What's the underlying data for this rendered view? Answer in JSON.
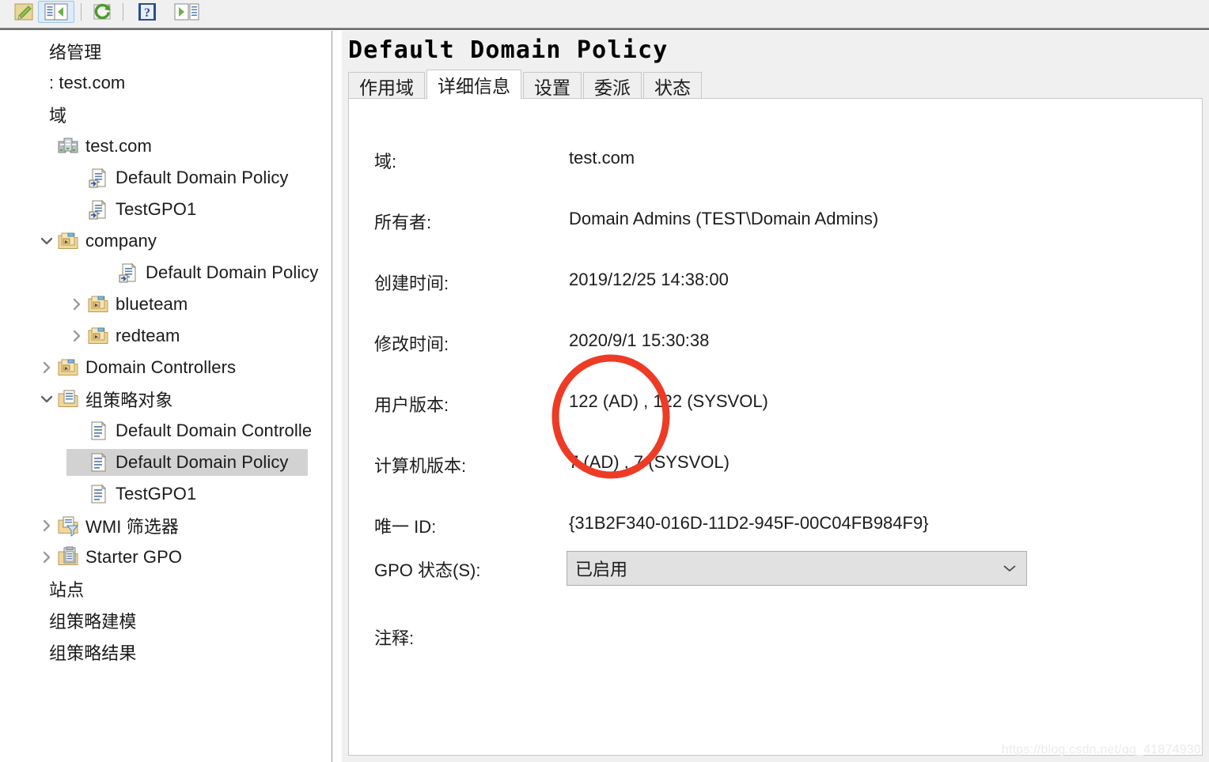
{
  "toolbar": {
    "buttons": [
      {
        "name": "edit-icon",
        "label": "编辑"
      },
      {
        "name": "show-hide-tree-icon",
        "label": "显示/隐藏控制台树",
        "selected": true
      },
      {
        "name": "refresh-icon",
        "label": "刷新"
      },
      {
        "name": "help-icon",
        "label": "帮助"
      },
      {
        "name": "export-icon",
        "label": "导出列表"
      }
    ]
  },
  "sidebar": {
    "items": [
      {
        "label": "络管理",
        "icon": "none",
        "indent": 0,
        "chevron": "none",
        "selected": false,
        "clipped": true
      },
      {
        "label": ": test.com",
        "icon": "none",
        "indent": 0,
        "chevron": "none",
        "selected": false,
        "clipped": true
      },
      {
        "label": "域",
        "icon": "none",
        "indent": 0,
        "chevron": "none",
        "selected": false,
        "clipped": true
      },
      {
        "label": "test.com",
        "icon": "domain-icon",
        "indent": 1,
        "chevron": "none",
        "selected": false
      },
      {
        "label": "Default Domain Policy",
        "icon": "gpo-link-icon",
        "indent": 2,
        "chevron": "none",
        "selected": false
      },
      {
        "label": "TestGPO1",
        "icon": "gpo-link-icon",
        "indent": 2,
        "chevron": "none",
        "selected": false
      },
      {
        "label": "company",
        "icon": "ou-folder-icon",
        "indent": 1,
        "chevron": "down",
        "selected": false
      },
      {
        "label": "Default Domain Policy",
        "icon": "gpo-link-icon",
        "indent": 3,
        "chevron": "none",
        "selected": false
      },
      {
        "label": "blueteam",
        "icon": "ou-folder-icon",
        "indent": 2,
        "chevron": "right",
        "selected": false
      },
      {
        "label": "redteam",
        "icon": "ou-folder-icon",
        "indent": 2,
        "chevron": "right",
        "selected": false
      },
      {
        "label": "Domain Controllers",
        "icon": "ou-folder-icon",
        "indent": 1,
        "chevron": "right",
        "selected": false
      },
      {
        "label": "组策略对象",
        "icon": "gpo-container-icon",
        "indent": 1,
        "chevron": "down",
        "selected": false
      },
      {
        "label": "Default Domain Controlle",
        "icon": "gpo-icon",
        "indent": 2,
        "chevron": "none",
        "selected": false
      },
      {
        "label": "Default Domain Policy",
        "icon": "gpo-icon",
        "indent": 2,
        "chevron": "none",
        "selected": true
      },
      {
        "label": "TestGPO1",
        "icon": "gpo-icon",
        "indent": 2,
        "chevron": "none",
        "selected": false
      },
      {
        "label": "WMI 筛选器",
        "icon": "wmi-filter-icon",
        "indent": 1,
        "chevron": "right",
        "selected": false
      },
      {
        "label": "Starter GPO",
        "icon": "starter-gpo-icon",
        "indent": 1,
        "chevron": "right",
        "selected": false
      },
      {
        "label": "站点",
        "icon": "none",
        "indent": 0,
        "chevron": "none",
        "selected": false,
        "clipped": true
      },
      {
        "label": "组策略建模",
        "icon": "none",
        "indent": 0,
        "chevron": "none",
        "selected": false,
        "clipped": true
      },
      {
        "label": "组策略结果",
        "icon": "none",
        "indent": 0,
        "chevron": "none",
        "selected": false,
        "clipped": true
      }
    ]
  },
  "panel": {
    "title": "Default Domain Policy",
    "tabs": [
      {
        "label": "作用域",
        "active": false
      },
      {
        "label": "详细信息",
        "active": true
      },
      {
        "label": "设置",
        "active": false
      },
      {
        "label": "委派",
        "active": false
      },
      {
        "label": "状态",
        "active": false
      }
    ],
    "details": [
      {
        "key": "域:",
        "value": "test.com"
      },
      {
        "key": "所有者:",
        "value": "Domain Admins (TEST\\Domain Admins)"
      },
      {
        "key": "创建时间:",
        "value": "2019/12/25 14:38:00"
      },
      {
        "key": "修改时间:",
        "value": "2020/9/1 15:30:38"
      },
      {
        "key": "用户版本:",
        "value": "122 (AD) , 122 (SYSVOL)"
      },
      {
        "key": "计算机版本:",
        "value": "7 (AD) , 7 (SYSVOL)"
      },
      {
        "key": "唯一 ID:",
        "value": "{31B2F340-016D-11D2-945F-00C04FB984F9}"
      }
    ],
    "gpo_status": {
      "key": "GPO 状态(S):",
      "value": "已启用"
    },
    "comment": {
      "key": "注释:",
      "value": ""
    }
  },
  "annotation": {
    "shape": "ellipse",
    "color": "#ee3b26",
    "target": "用户版本 / 计算机版本 值"
  },
  "watermark": {
    "text": "https://blog.csdn.net/qq_41874930"
  }
}
